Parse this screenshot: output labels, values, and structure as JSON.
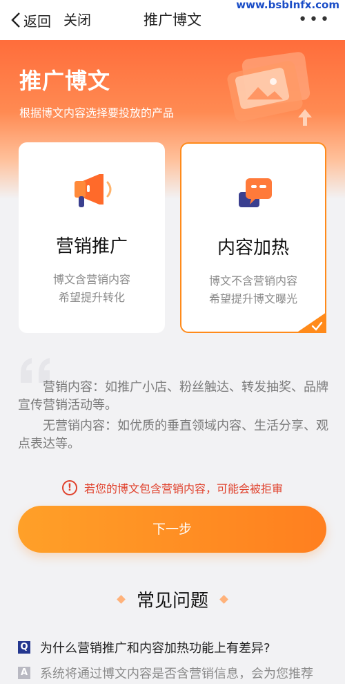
{
  "nav": {
    "back_label": "返回",
    "close_label": "关闭",
    "title": "推广博文",
    "more_label": "•••",
    "watermark": "www.bsbInfx.com"
  },
  "hero": {
    "title": "推广博文",
    "subtitle": "根据博文内容选择要投放的产品"
  },
  "cards": [
    {
      "title": "营销推广",
      "desc_line1": "博文含营销内容",
      "desc_line2": "希望提升转化",
      "selected": false,
      "icon": "megaphone-icon"
    },
    {
      "title": "内容加热",
      "desc_line1": "博文不含营销内容",
      "desc_line2": "希望提升博文曝光",
      "selected": true,
      "icon": "chat-bubbles-icon"
    }
  ],
  "notes": [
    "营销内容：如推广小店、粉丝触达、转发抽奖、品牌宣传营销活动等。",
    "无营销内容：如优质的垂直领域内容、生活分享、观点表达等。"
  ],
  "warning": {
    "icon": "!",
    "text": "若您的博文包含营销内容，可能会被拒审"
  },
  "next_button": "下一步",
  "faq": {
    "title": "常见问题",
    "q_badge": "Q",
    "a_badge": "A",
    "question": "为什么营销推广和内容加热功能上有差异?",
    "answer": "系统将通过博文内容是否含营销信息，会为您推荐"
  },
  "colors": {
    "accent": "#ff8a1a",
    "warning": "#e0412c",
    "hero_top": "#ff6d3b",
    "q_badge": "#24378f"
  }
}
